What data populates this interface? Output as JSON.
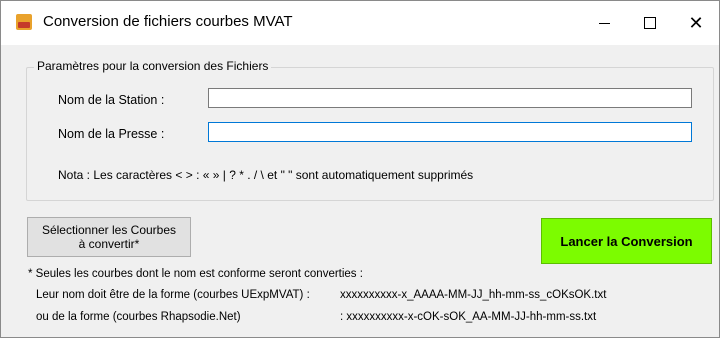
{
  "window": {
    "title": "Conversion de fichiers courbes MVAT",
    "icon": "app-press-icon",
    "controls": {
      "minimize": "minimize-icon",
      "maximize": "maximize-icon",
      "close": "close-icon"
    }
  },
  "group": {
    "legend": "Paramètres pour la conversion des Fichiers",
    "station_label": "Nom de la Station :",
    "station_value": "",
    "presse_label": "Nom de la Presse :",
    "presse_value": "",
    "nota": "Nota : Les caractères < > : « » | ? * . / \\ et \" \" sont automatiquement supprimés"
  },
  "buttons": {
    "select_line1": "Sélectionner les Courbes",
    "select_line2": "à convertir*",
    "launch": "Lancer la Conversion",
    "launch_color": "#7cfc00"
  },
  "notes": {
    "line1": "* Seules les courbes dont le nom est conforme seront converties :",
    "line2_label": "Leur nom doit être de la forme (courbes UExpMVAT) :",
    "line2_value": "xxxxxxxxxx-x_AAAA-MM-JJ_hh-mm-ss_cOKsOK.txt",
    "line3_label": "ou de la forme (courbes Rhapsodie.Net)",
    "line3_value": ": xxxxxxxxxx-x-cOK-sOK_AA-MM-JJ-hh-mm-ss.txt"
  }
}
